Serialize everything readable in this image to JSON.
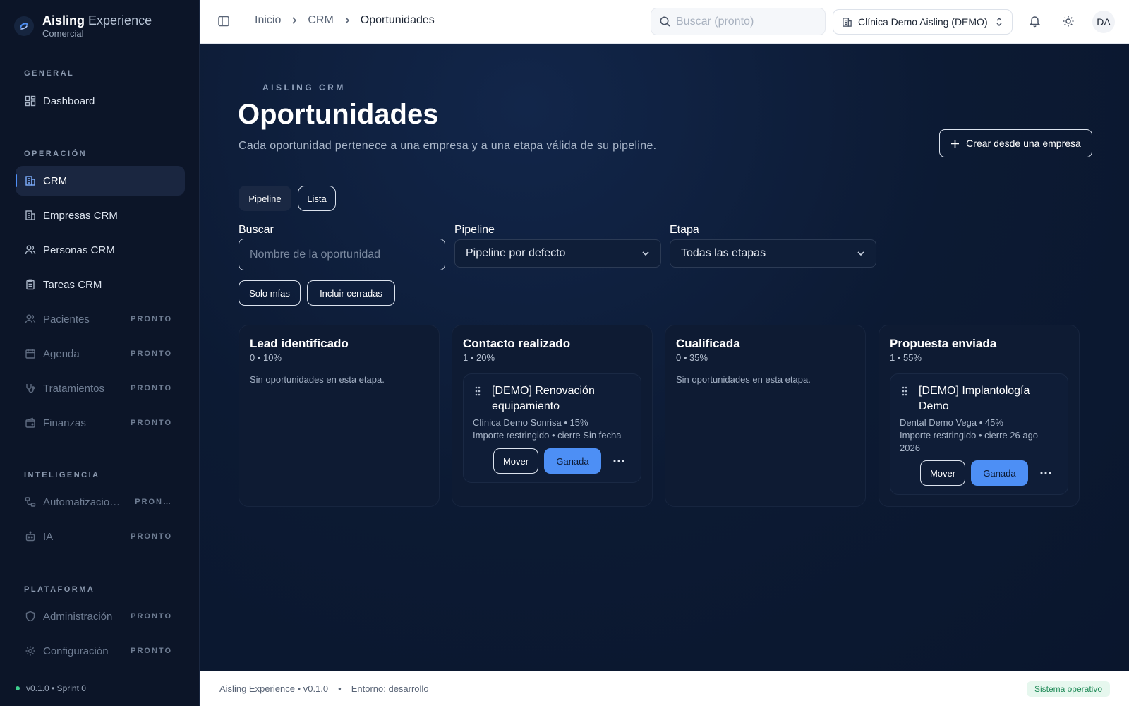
{
  "brand": {
    "name_bold": "Aisling",
    "name_light": "Experience",
    "subtitle": "Comercial"
  },
  "sidebar": {
    "sections": [
      {
        "label": "GENERAL",
        "items": [
          {
            "label": "Dashboard",
            "icon": "dashboard-icon",
            "badge": ""
          }
        ]
      },
      {
        "label": "OPERACIÓN",
        "items": [
          {
            "label": "CRM",
            "icon": "building-icon",
            "badge": ""
          },
          {
            "label": "Empresas CRM",
            "icon": "building-icon",
            "badge": ""
          },
          {
            "label": "Personas CRM",
            "icon": "users-icon",
            "badge": ""
          },
          {
            "label": "Tareas CRM",
            "icon": "clipboard-icon",
            "badge": ""
          },
          {
            "label": "Pacientes",
            "icon": "users-icon",
            "badge": "PRONTO"
          },
          {
            "label": "Agenda",
            "icon": "calendar-icon",
            "badge": "PRONTO"
          },
          {
            "label": "Tratamientos",
            "icon": "stethoscope-icon",
            "badge": "PRONTO"
          },
          {
            "label": "Finanzas",
            "icon": "wallet-icon",
            "badge": "PRONTO"
          }
        ]
      },
      {
        "label": "INTELIGENCIA",
        "items": [
          {
            "label": "Automatizacio…",
            "icon": "workflow-icon",
            "badge": "PRON…"
          },
          {
            "label": "IA",
            "icon": "bot-icon",
            "badge": "PRONTO"
          }
        ]
      },
      {
        "label": "PLATAFORMA",
        "items": [
          {
            "label": "Administración",
            "icon": "shield-icon",
            "badge": "PRONTO"
          },
          {
            "label": "Configuración",
            "icon": "gear-icon",
            "badge": "PRONTO"
          }
        ]
      }
    ],
    "version": "v0.1.0 • Sprint 0"
  },
  "topbar": {
    "breadcrumbs": [
      "Inicio",
      "CRM",
      "Oportunidades"
    ],
    "search_placeholder": "Buscar (pronto)",
    "tenant": "Clínica Demo Aisling (DEMO)",
    "avatar": "DA"
  },
  "page": {
    "eyebrow": "AISLING CRM",
    "title": "Oportunidades",
    "subtitle": "Cada oportunidad pertenece a una empresa y a una etapa válida de su pipeline.",
    "create_button": "Crear desde una empresa",
    "view_tabs": [
      "Pipeline",
      "Lista"
    ]
  },
  "filters": {
    "search_label": "Buscar",
    "search_placeholder": "Nombre de la oportunidad",
    "pipeline_label": "Pipeline",
    "pipeline_value": "Pipeline por defecto",
    "stage_label": "Etapa",
    "stage_value": "Todas las etapas",
    "chips": [
      "Solo mías",
      "Incluir cerradas"
    ]
  },
  "columns": [
    {
      "title": "Lead identificado",
      "meta": "0 • 10%",
      "empty": "Sin oportunidades en esta etapa."
    },
    {
      "title": "Contacto realizado",
      "meta": "1 • 20%",
      "empty": "",
      "card": {
        "title": "[DEMO] Renovación equipamiento",
        "line1": "Clínica Demo Sonrisa • 15%",
        "line2": "Importe restringido • cierre Sin fecha",
        "line3": "",
        "move": "Mover",
        "won": "Ganada"
      }
    },
    {
      "title": "Cualificada",
      "meta": "0 • 35%",
      "empty": "Sin oportunidades en esta etapa."
    },
    {
      "title": "Propuesta enviada",
      "meta": "1 • 55%",
      "empty": "",
      "card": {
        "title": "[DEMO] Implantología Demo",
        "line1": "Dental Demo Vega • 45%",
        "line2": "Importe restringido • cierre 26 ago",
        "line3": "2026",
        "move": "Mover",
        "won": "Ganada"
      }
    }
  ],
  "footer": {
    "app": "Aisling Experience • v0.1.0",
    "sep": "•",
    "env": "Entorno: desarrollo",
    "status": "Sistema operativo"
  },
  "colors": {
    "accent": "#4d8ff5",
    "sidebar_bg": "#0c1528",
    "main_bg": "#0c1930",
    "status_ok": "#3ecf8e"
  }
}
